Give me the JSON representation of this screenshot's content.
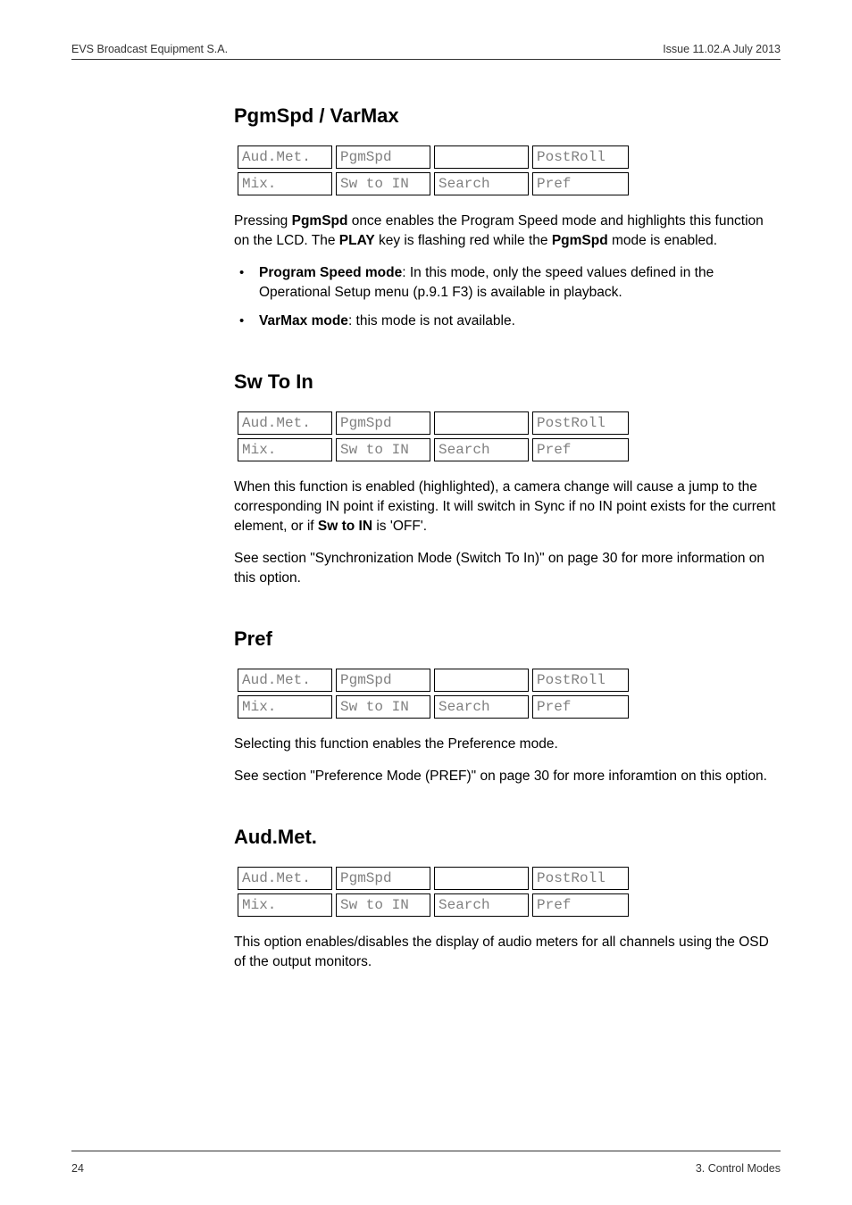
{
  "header": {
    "left": "EVS Broadcast Equipment S.A.",
    "right": "Issue 11.02.A  July 2013"
  },
  "footer": {
    "left": "24",
    "right": "3. Control Modes"
  },
  "sections": {
    "pgmspd": {
      "title": "PgmSpd / VarMax",
      "lcd": {
        "r0c0": "Aud.Met.",
        "r0c1": "PgmSpd",
        "r0c2": "",
        "r0c3": "PostRoll",
        "r1c0": "Mix.",
        "r1c1": "Sw to IN",
        "r1c2": "Search",
        "r1c3": "Pref"
      },
      "p1_a": "Pressing ",
      "p1_b": "PgmSpd",
      "p1_c": " once enables the Program Speed mode and highlights this function on the LCD. The ",
      "p1_d": "PLAY",
      "p1_e": " key is flashing red while the ",
      "p1_f": "PgmSpd",
      "p1_g": " mode is enabled.",
      "b1_a": "Program Speed mode",
      "b1_b": ": In this mode, only the speed values defined in the Operational Setup menu (p.9.1 F3) is available in playback.",
      "b2_a": "VarMax mode",
      "b2_b": ": this mode is not available."
    },
    "swtoin": {
      "title": "Sw To In",
      "lcd": {
        "r0c0": "Aud.Met.",
        "r0c1": "PgmSpd",
        "r0c2": "",
        "r0c3": "PostRoll",
        "r1c0": "Mix.",
        "r1c1": "Sw to IN",
        "r1c2": "Search",
        "r1c3": "Pref"
      },
      "p1_a": "When this function is enabled (highlighted), a camera change will cause a jump to the corresponding IN point if existing. It will switch in Sync if no IN point exists for the current element, or if ",
      "p1_b": "Sw to IN",
      "p1_c": " is 'OFF'.",
      "p2": "See section \"Synchronization Mode (Switch To In)\" on page 30 for more information on this option."
    },
    "pref": {
      "title": "Pref",
      "lcd": {
        "r0c0": "Aud.Met.",
        "r0c1": "PgmSpd",
        "r0c2": "",
        "r0c3": "PostRoll",
        "r1c0": "Mix.",
        "r1c1": "Sw to IN",
        "r1c2": "Search",
        "r1c3": "Pref"
      },
      "p1": "Selecting this function enables the Preference mode.",
      "p2": "See section \"Preference Mode (PREF)\" on page 30 for more inforamtion on this option."
    },
    "audmet": {
      "title": "Aud.Met.",
      "lcd": {
        "r0c0": "Aud.Met.",
        "r0c1": "PgmSpd",
        "r0c2": "",
        "r0c3": "PostRoll",
        "r1c0": "Mix.",
        "r1c1": "Sw to IN",
        "r1c2": "Search",
        "r1c3": "Pref"
      },
      "p1": "This option enables/disables the display of audio meters for all channels using the OSD of the output monitors."
    }
  }
}
